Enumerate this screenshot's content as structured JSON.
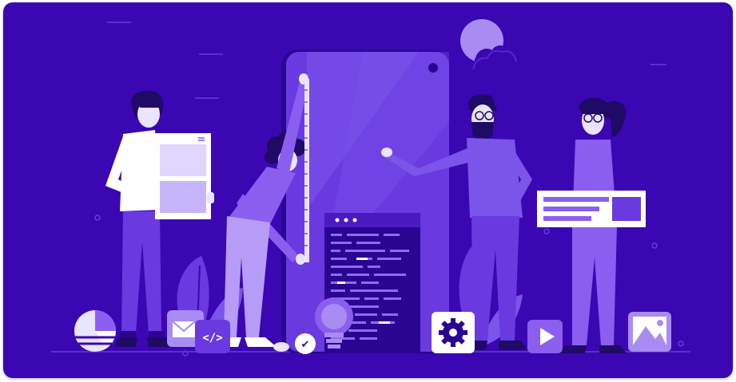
{
  "illustration": {
    "colors": {
      "background": "#3a07b2",
      "phone": "#6a3ae0",
      "phone_dark": "#2a0592",
      "accent_light": "#a98cf2",
      "accent_mid": "#7b55ea",
      "white": "#ffffff",
      "skin": "#e9e4ff",
      "hair": "#1f0a66"
    },
    "icons": [
      {
        "name": "pie-chart-icon"
      },
      {
        "name": "mail-icon"
      },
      {
        "name": "code-icon",
        "label": "</>"
      },
      {
        "name": "checkmark-icon",
        "label": "✔"
      },
      {
        "name": "lightbulb-icon"
      },
      {
        "name": "gear-icon"
      },
      {
        "name": "play-icon"
      },
      {
        "name": "image-icon"
      }
    ]
  }
}
